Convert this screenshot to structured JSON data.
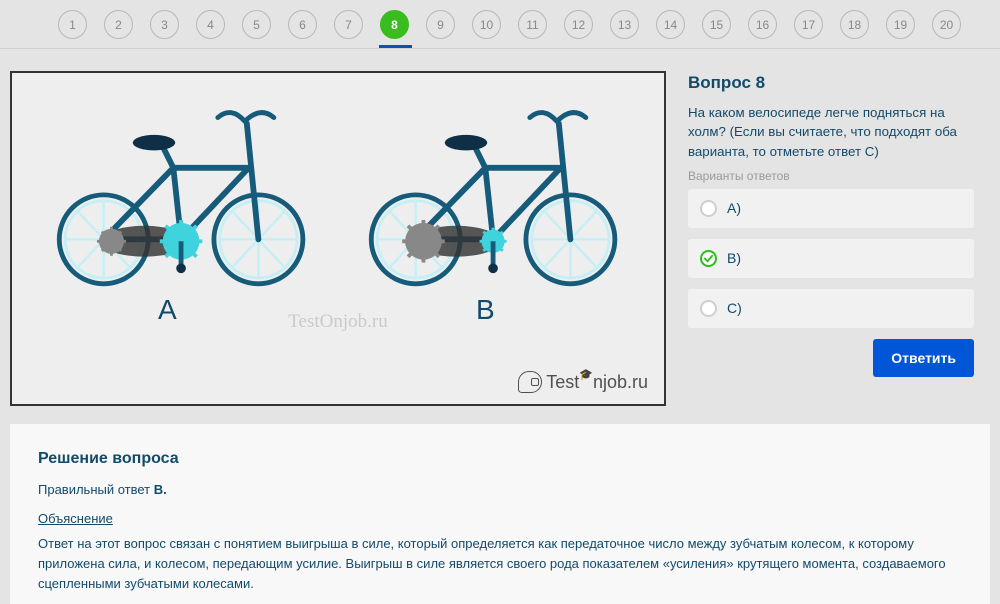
{
  "nav": {
    "items": [
      "1",
      "2",
      "3",
      "4",
      "5",
      "6",
      "7",
      "8",
      "9",
      "10",
      "11",
      "12",
      "13",
      "14",
      "15",
      "16",
      "17",
      "18",
      "19",
      "20"
    ],
    "active_index": 7
  },
  "question": {
    "title": "Вопрос 8",
    "text": "На каком велосипеде легче подняться на холм? (Если вы считаете, что подходят оба варианта, то отметьте ответ С)",
    "options_caption": "Варианты ответов",
    "answers": [
      {
        "label": "A)"
      },
      {
        "label": "B)"
      },
      {
        "label": "C)"
      }
    ],
    "selected_index": 1,
    "submit_label": "Ответить"
  },
  "image": {
    "label_a": "A",
    "label_b": "B",
    "watermark": "TestOnjob.ru",
    "logo_text": "TestOnjob.ru"
  },
  "solution": {
    "title": "Решение вопроса",
    "line_prefix": "Правильный ответ ",
    "line_bold": "B.",
    "subheading": "Объяснение",
    "body": "Ответ на этот вопрос связан с понятием выигрыша в силе, который определяется как передаточное число между зубчатым колесом, к которому приложена сила, и колесом, передающим усилие. Выигрыш в силе является своего рода показателем «усиления» крутящего момента, создаваемого сцепленными зубчатыми колесами."
  }
}
